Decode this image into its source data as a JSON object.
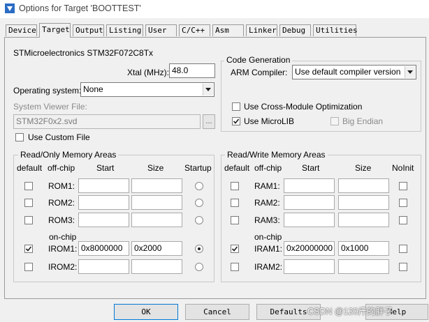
{
  "window": {
    "title": "Options for Target 'BOOTTEST'"
  },
  "tabs": [
    "Device",
    "Target",
    "Output",
    "Listing",
    "User",
    "C/C++",
    "Asm",
    "Linker",
    "Debug",
    "Utilities"
  ],
  "active_tab": "Target",
  "target": {
    "device_name": "STMicroelectronics STM32F072C8Tx",
    "xtal_label": "Xtal (MHz):",
    "xtal_value": "48.0",
    "os_label": "Operating system:",
    "os_value": "None",
    "svd_label": "System Viewer File:",
    "svd_value": "STM32F0x2.svd",
    "svd_browse": "...",
    "custom_file_label": "Use Custom File",
    "custom_file_checked": false
  },
  "code_generation": {
    "title": "Code Generation",
    "compiler_label": "ARM Compiler:",
    "compiler_value": "Use default compiler version",
    "cross_module_label": "Use Cross-Module Optimization",
    "cross_module_checked": false,
    "microlib_label": "Use MicroLIB",
    "microlib_checked": true,
    "big_endian_label": "Big Endian",
    "big_endian_checked": false
  },
  "ro_memory": {
    "title": "Read/Only Memory Areas",
    "headers": {
      "default": "default",
      "offchip": "off-chip",
      "start": "Start",
      "size": "Size",
      "last": "Startup"
    },
    "onchip_label": "on-chip",
    "rows": [
      {
        "label": "ROM1:",
        "default": false,
        "start": "",
        "size": "",
        "startup": false
      },
      {
        "label": "ROM2:",
        "default": false,
        "start": "",
        "size": "",
        "startup": false
      },
      {
        "label": "ROM3:",
        "default": false,
        "start": "",
        "size": "",
        "startup": false
      },
      {
        "label": "IROM1:",
        "default": true,
        "start": "0x8000000",
        "size": "0x2000",
        "startup": true
      },
      {
        "label": "IROM2:",
        "default": false,
        "start": "",
        "size": "",
        "startup": false
      }
    ]
  },
  "rw_memory": {
    "title": "Read/Write Memory Areas",
    "headers": {
      "default": "default",
      "offchip": "off-chip",
      "start": "Start",
      "size": "Size",
      "last": "NoInit"
    },
    "onchip_label": "on-chip",
    "rows": [
      {
        "label": "RAM1:",
        "default": false,
        "start": "",
        "size": "",
        "noinit": false
      },
      {
        "label": "RAM2:",
        "default": false,
        "start": "",
        "size": "",
        "noinit": false
      },
      {
        "label": "RAM3:",
        "default": false,
        "start": "",
        "size": "",
        "noinit": false
      },
      {
        "label": "IRAM1:",
        "default": true,
        "start": "0x20000000",
        "size": "0x1000",
        "noinit": false
      },
      {
        "label": "IRAM2:",
        "default": false,
        "start": "",
        "size": "",
        "noinit": false
      }
    ]
  },
  "buttons": {
    "ok": "OK",
    "cancel": "Cancel",
    "defaults": "Defaults",
    "help": "Help"
  },
  "watermark": "CSDN @120斤的胖子"
}
